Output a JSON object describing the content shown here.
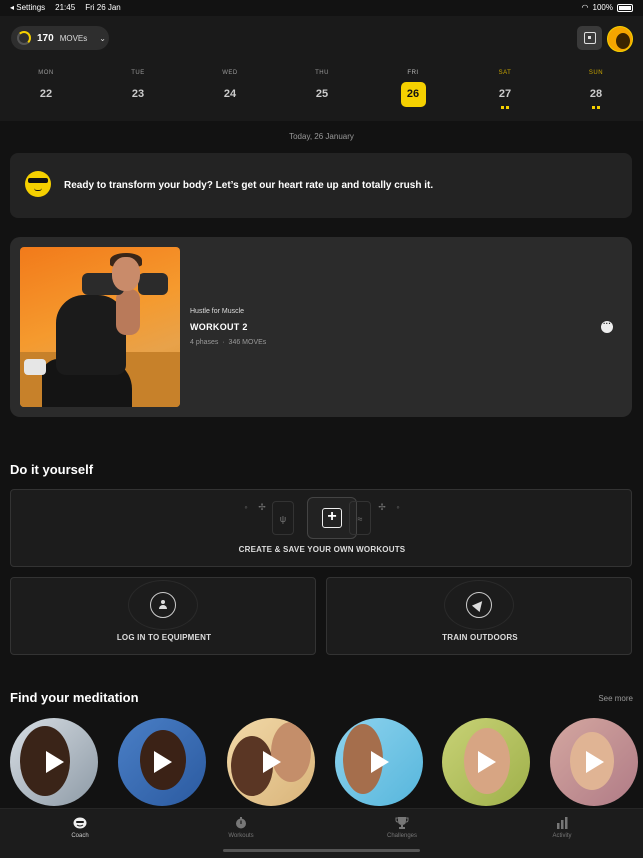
{
  "status_bar": {
    "back_label": "◂ Settings",
    "time": "21:45",
    "date": "Fri 26 Jan",
    "battery": "100%"
  },
  "header": {
    "moves_value": "170",
    "moves_unit": "MOVEs",
    "moves_progress": 0.25
  },
  "colors": {
    "accent": "#f5d000",
    "background": "#121212",
    "card": "#2b2b2b"
  },
  "week": {
    "days": [
      {
        "name": "MON",
        "date": "22"
      },
      {
        "name": "TUE",
        "date": "23"
      },
      {
        "name": "WED",
        "date": "24"
      },
      {
        "name": "THU",
        "date": "25"
      },
      {
        "name": "FRI",
        "date": "26"
      },
      {
        "name": "SAT",
        "date": "27"
      },
      {
        "name": "SUN",
        "date": "28"
      }
    ],
    "today_index": 4,
    "today_label": "Today, 26 January"
  },
  "banner": {
    "text": "Ready to transform your body? Let’s get our heart rate up and totally crush it.",
    "icon": "sunglasses-emoji-icon"
  },
  "workout": {
    "brand": "Hustle for Muscle",
    "title": "WORKOUT 2",
    "phases": "4 phases",
    "separator": "·",
    "moves": "346 MOVEs",
    "more": "···"
  },
  "diy": {
    "title": "Do it yourself",
    "create_label": "CREATE & SAVE YOUR OWN WORKOUTS",
    "plus": "+",
    "login_label": "LOG IN TO EQUIPMENT",
    "outdoors_label": "TRAIN OUTDOORS"
  },
  "meditation": {
    "title": "Find your meditation",
    "see_more": "See more",
    "items": [
      "meditation-1",
      "meditation-2",
      "meditation-3",
      "meditation-4",
      "meditation-5",
      "meditation-6"
    ]
  },
  "tabs": [
    {
      "label": "Coach",
      "icon": "coach-icon"
    },
    {
      "label": "Workouts",
      "icon": "workouts-icon"
    },
    {
      "label": "Challenges",
      "icon": "trophy-icon"
    },
    {
      "label": "Activity",
      "icon": "bar-chart-icon"
    }
  ]
}
